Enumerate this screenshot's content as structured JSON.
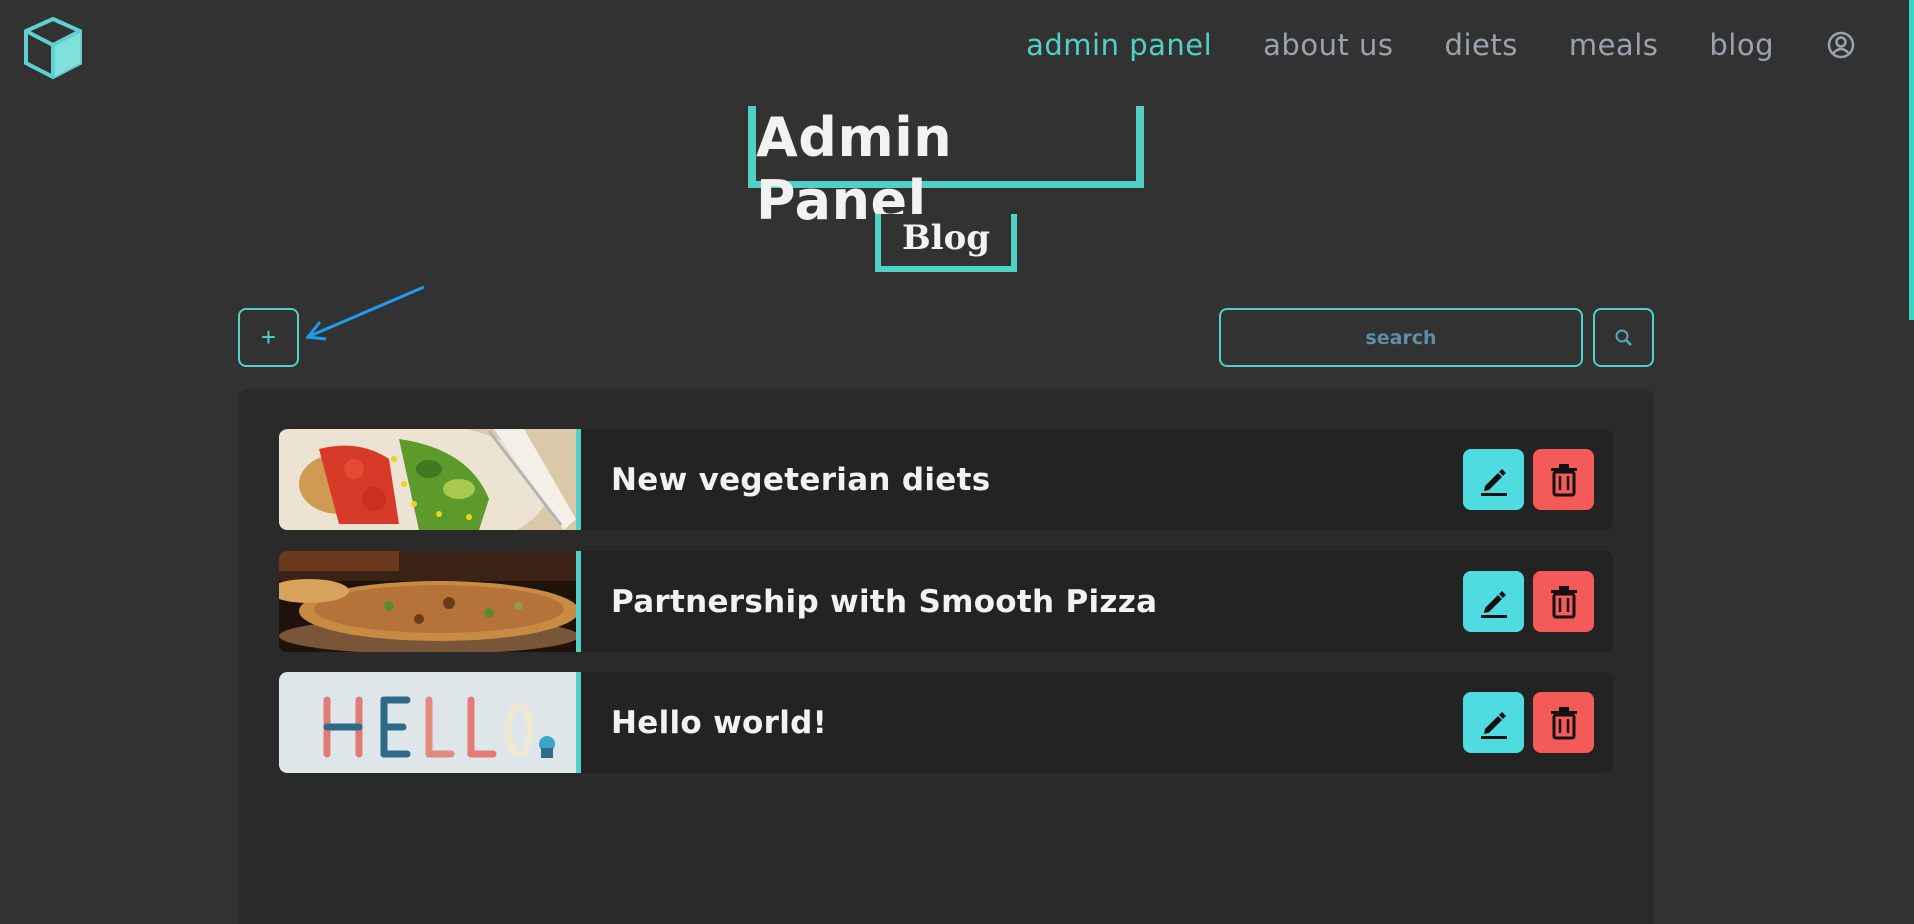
{
  "nav": {
    "items": [
      {
        "label": "admin panel",
        "active": true
      },
      {
        "label": "about us",
        "active": false
      },
      {
        "label": "diets",
        "active": false
      },
      {
        "label": "meals",
        "active": false
      },
      {
        "label": "blog",
        "active": false
      }
    ],
    "user_icon": "user-circle-icon"
  },
  "header": {
    "title": "Admin Panel",
    "section": "Blog"
  },
  "toolbar": {
    "add_label": "+",
    "search_placeholder": "search",
    "search_icon": "search-icon"
  },
  "posts": [
    {
      "title": "New vegeterian diets",
      "image": "salad-image"
    },
    {
      "title": "Partnership with Smooth Pizza",
      "image": "pizza-image"
    },
    {
      "title": "Hello world!",
      "image": "hello-letters-image"
    }
  ],
  "colors": {
    "background": "#323232",
    "accent": "#4fd2c5",
    "edit": "#4fdce0",
    "delete": "#f45a58",
    "annotation_arrow": "#1e9cf0"
  }
}
